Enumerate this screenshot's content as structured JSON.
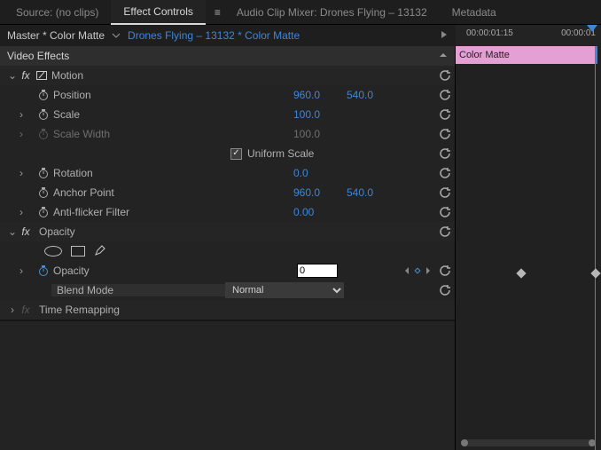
{
  "tabs": {
    "source": "Source: (no clips)",
    "effect_controls": "Effect Controls",
    "mixer": "Audio Clip Mixer: Drones Flying – 13132",
    "metadata": "Metadata"
  },
  "breadcrumb": {
    "master": "Master * Color Matte",
    "clip": "Drones Flying – 13132 * Color Matte"
  },
  "timecode": {
    "t1": "00:00:01:15",
    "t2": "00:00:01"
  },
  "section": "Video Effects",
  "motion": {
    "title": "Motion",
    "position": {
      "label": "Position",
      "x": "960.0",
      "y": "540.0"
    },
    "scale": {
      "label": "Scale",
      "v": "100.0"
    },
    "scale_w": {
      "label": "Scale Width",
      "v": "100.0"
    },
    "uniform": {
      "label": "Uniform Scale"
    },
    "rotation": {
      "label": "Rotation",
      "v": "0.0"
    },
    "anchor": {
      "label": "Anchor Point",
      "x": "960.0",
      "y": "540.0"
    },
    "flicker": {
      "label": "Anti-flicker Filter",
      "v": "0.00"
    }
  },
  "opacity": {
    "title": "Opacity",
    "prop": {
      "label": "Opacity",
      "v": "0"
    },
    "blend": {
      "label": "Blend Mode",
      "v": "Normal"
    }
  },
  "time_remap": {
    "title": "Time Remapping"
  },
  "clipbar": "Color Matte"
}
